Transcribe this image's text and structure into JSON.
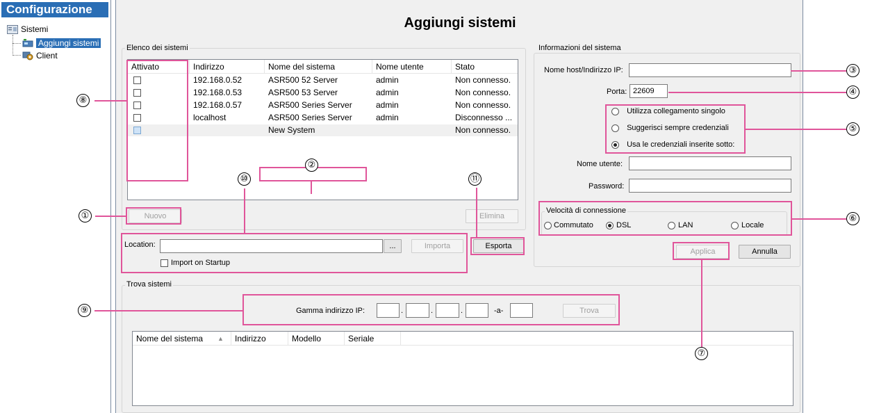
{
  "nav": {
    "header": "Configurazione",
    "items": [
      {
        "label": "Sistemi"
      },
      {
        "label": "Aggiungi sistemi"
      },
      {
        "label": "Client"
      }
    ]
  },
  "page": {
    "title": "Aggiungi sistemi"
  },
  "systems_list": {
    "group_label": "Elenco dei sistemi",
    "columns": [
      "Attivato",
      "Indirizzo",
      "Nome del sistema",
      "Nome utente",
      "Stato"
    ],
    "rows": [
      {
        "checked": false,
        "address": "192.168.0.52",
        "name": "ASR500 52 Server",
        "user": "admin",
        "status": "Non connesso."
      },
      {
        "checked": false,
        "address": "192.168.0.53",
        "name": "ASR500 53 Server",
        "user": "admin",
        "status": "Non connesso."
      },
      {
        "checked": false,
        "address": "192.168.0.57",
        "name": "ASR500 Series Server",
        "user": "admin",
        "status": "Non connesso."
      },
      {
        "checked": false,
        "address": "localhost",
        "name": "ASR500 Series Server",
        "user": "admin",
        "status": "Disconnesso ..."
      },
      {
        "checked": false,
        "address": "",
        "name": "New System",
        "user": "",
        "status": "Non connesso."
      }
    ],
    "new_label": "Nuovo",
    "delete_label": "Elimina"
  },
  "location": {
    "label": "Location:",
    "value": "",
    "browse_label": "...",
    "import_label": "Importa",
    "export_label": "Esporta",
    "import_on_startup": "Import on Startup"
  },
  "system_info": {
    "group_label": "Informazioni del sistema",
    "host_label": "Nome host/Indirizzo IP:",
    "host_value": "",
    "port_label": "Porta:",
    "port_value": "22609",
    "login_options": [
      {
        "label": "Utilizza collegamento singolo",
        "selected": false
      },
      {
        "label": "Suggerisci sempre credenziali",
        "selected": false
      },
      {
        "label": "Usa le credenziali inserite sotto:",
        "selected": true
      }
    ],
    "username_label": "Nome utente:",
    "username_value": "",
    "password_label": "Password:",
    "password_value": "",
    "speed_label": "Velocità di connessione",
    "speed_options": [
      {
        "label": "Commutato",
        "selected": false
      },
      {
        "label": "DSL",
        "selected": true
      },
      {
        "label": "LAN",
        "selected": false
      },
      {
        "label": "Locale",
        "selected": false
      }
    ],
    "apply_label": "Applica",
    "cancel_label": "Annulla"
  },
  "find_systems": {
    "group_label": "Trova sistemi",
    "range_label": "Gamma indirizzo IP:",
    "separator": "-a-",
    "dot": ".",
    "find_label": "Trova",
    "columns": [
      "Nome del sistema",
      "Indirizzo",
      "Modello",
      "Seriale"
    ],
    "sort_icon": "sort-ascending-icon"
  },
  "callouts": [
    "①",
    "②",
    "③",
    "④",
    "⑤",
    "⑥",
    "⑦",
    "⑧",
    "⑨",
    "⑩",
    "⑪"
  ],
  "colors": {
    "accent": "#2a6eb5",
    "callout": "#e0559a",
    "panel": "#f0f0f0"
  }
}
